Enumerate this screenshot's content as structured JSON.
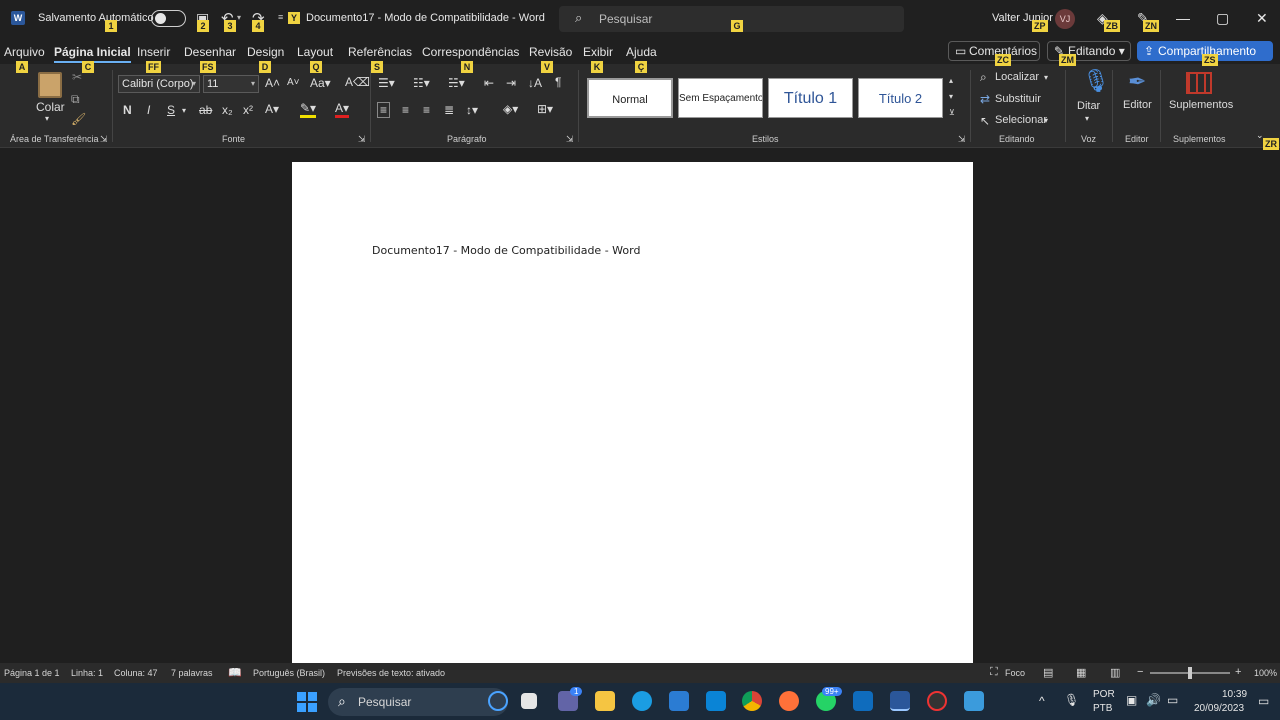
{
  "titlebar": {
    "autosave_label": "Salvamento Automático",
    "doc_title": "Documento17  -  Modo de Compatibilidade  -  Word",
    "search_placeholder": "Pesquisar",
    "user_name": "Valter Junior",
    "user_initials": "VJ"
  },
  "keytips": {
    "autosave": "1",
    "save": "2",
    "undo": "3",
    "redo": "4",
    "qat": "Y",
    "search": "G",
    "user": "ZP",
    "diamond": "ZB",
    "pen": "ZN",
    "arquivo": "A",
    "inicial": "C",
    "fonte_font": "FF",
    "fonte_size": "FS",
    "design": "D",
    "layout": "Q",
    "referencias": "S",
    "corresp": "N",
    "revisao": "V",
    "exibir": "K",
    "ajuda": "Ç",
    "comentarios": "ZC",
    "editando": "ZM",
    "compart": "ZS",
    "ribbon_opts": "ZR"
  },
  "tabs": [
    "Arquivo",
    "Página Inicial",
    "Inserir",
    "Desenhar",
    "Design",
    "Layout",
    "Referências",
    "Correspondências",
    "Revisão",
    "Exibir",
    "Ajuda"
  ],
  "actions": {
    "comentarios": "Comentários",
    "editando": "Editando",
    "compartilhamento": "Compartilhamento"
  },
  "ribbon": {
    "clipboard": {
      "paste": "Colar",
      "label": "Área de Transferência"
    },
    "font": {
      "family": "Calibri (Corpo)",
      "size": "11",
      "bold": "N",
      "italic": "I",
      "underline": "S",
      "label": "Fonte"
    },
    "paragraph": {
      "label": "Parágrafo"
    },
    "styles": {
      "items": [
        "Normal",
        "Sem Espaçamento",
        "Título 1",
        "Título 2"
      ],
      "label": "Estilos"
    },
    "editing": {
      "find": "Localizar",
      "replace": "Substituir",
      "select": "Selecionar",
      "label": "Editando"
    },
    "voice": {
      "dictate": "Ditar",
      "label": "Voz"
    },
    "editor": {
      "name": "Editor",
      "label": "Editor"
    },
    "addins": {
      "name": "Suplementos",
      "label": "Suplementos"
    }
  },
  "document": {
    "line1": "Documento17  -  Modo de Compatibilidade - Word"
  },
  "status": {
    "page": "Página 1 de 1",
    "line": "Linha: 1",
    "column": "Coluna: 47",
    "words": "7 palavras",
    "language": "Português (Brasil)",
    "predictions": "Previsões de texto: ativado",
    "focus": "Foco",
    "zoom": "100%"
  },
  "taskbar": {
    "search_placeholder": "Pesquisar",
    "lang1": "POR",
    "lang2": "PTB",
    "time": "10:39",
    "date": "20/09/2023",
    "teams_badge": "1",
    "whatsapp_badge": "99+"
  },
  "colors": {
    "accent": "#2f6dcc",
    "keytip": "#f0d341",
    "tab_underline": "#6ab0f3"
  }
}
